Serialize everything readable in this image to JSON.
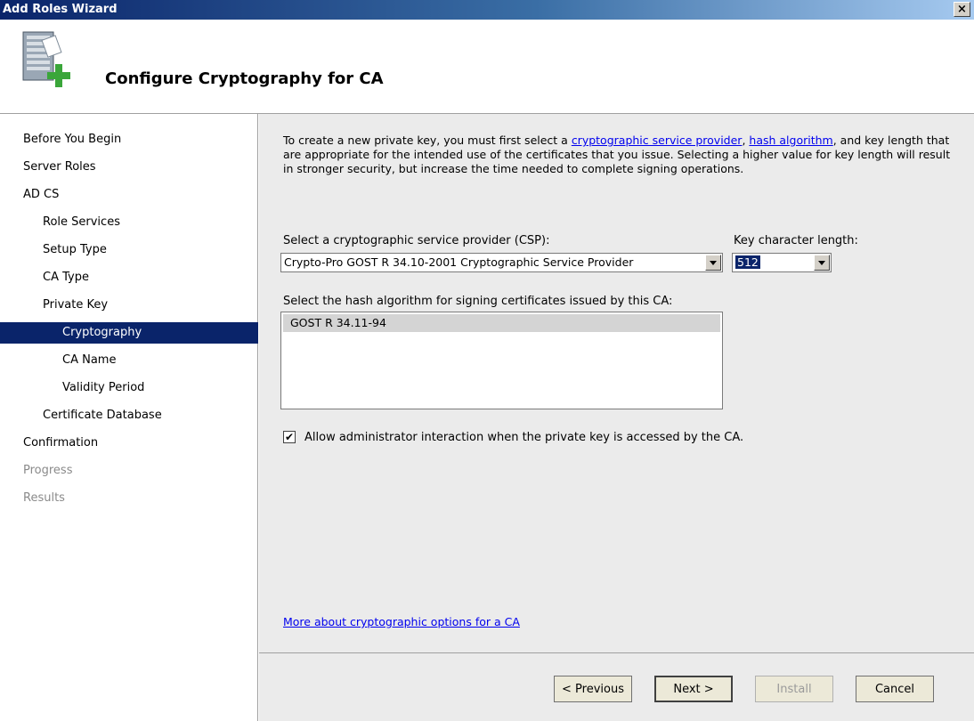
{
  "window": {
    "title": "Add Roles Wizard",
    "close_glyph": "×"
  },
  "header": {
    "title": "Configure Cryptography for CA",
    "icon": "server-add-icon"
  },
  "sidebar": {
    "items": [
      {
        "label": "Before You Begin",
        "state": "normal"
      },
      {
        "label": "Server Roles",
        "state": "normal"
      },
      {
        "label": "AD CS",
        "state": "normal"
      },
      {
        "label": "Role Services",
        "state": "normal"
      },
      {
        "label": "Setup Type",
        "state": "normal"
      },
      {
        "label": "CA Type",
        "state": "normal"
      },
      {
        "label": "Private Key",
        "state": "normal"
      },
      {
        "label": "Cryptography",
        "state": "selected"
      },
      {
        "label": "CA Name",
        "state": "normal"
      },
      {
        "label": "Validity Period",
        "state": "normal"
      },
      {
        "label": "Certificate Database",
        "state": "normal"
      },
      {
        "label": "Confirmation",
        "state": "normal"
      },
      {
        "label": "Progress",
        "state": "disabled"
      },
      {
        "label": "Results",
        "state": "disabled"
      }
    ]
  },
  "main": {
    "description": {
      "part1": "To create a new private key, you must first select a ",
      "link1": "cryptographic service provider",
      "part2": ", ",
      "link2": "hash algorithm",
      "part3": ", and key length that are appropriate for the intended use of the certificates that you issue. Selecting a higher value for key length will result in stronger security, but increase the time needed to complete signing operations."
    },
    "csp_label": "Select a cryptographic service provider (CSP):",
    "csp_value": "Crypto-Pro GOST R 34.10-2001 Cryptographic Service Provider",
    "key_length_label": "Key character length:",
    "key_length_value": "512",
    "hash_label": "Select the hash algorithm for signing certificates issued by this CA:",
    "hash_items": [
      "GOST R 34.11-94"
    ],
    "checkbox_label": "Allow administrator interaction when the private key is accessed by the CA.",
    "checkbox_checked": true,
    "checkbox_glyph": "✔",
    "more_link": "More about cryptographic options for a CA"
  },
  "footer": {
    "previous": "< Previous",
    "next": "Next >",
    "install": "Install",
    "cancel": "Cancel"
  }
}
